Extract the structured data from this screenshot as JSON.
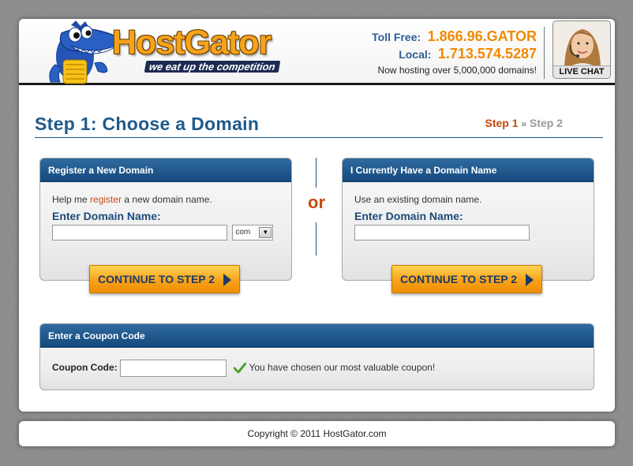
{
  "header": {
    "logo_text": "HostGator",
    "tagline": "we eat up the competition",
    "toll_free_label": "Toll Free:",
    "toll_free_number": "1.866.96.GATOR",
    "local_label": "Local:",
    "local_number": "1.713.574.5287",
    "hosting_note": "Now hosting over 5,000,000 domains!",
    "live_chat_label": "LIVE CHAT"
  },
  "step": {
    "title": "Step 1: Choose a Domain",
    "current": "Step 1",
    "separator": "»",
    "next": "Step 2"
  },
  "register_panel": {
    "header": "Register a New Domain",
    "help_prefix": "Help me ",
    "help_link": "register",
    "help_suffix": " a new domain name.",
    "field_label": "Enter Domain Name:",
    "domain_value": "",
    "tld_selected": "com",
    "button_label": "CONTINUE TO STEP 2"
  },
  "divider_text": "or",
  "existing_panel": {
    "header": "I Currently Have a Domain Name",
    "help_text": "Use an existing domain name.",
    "field_label": "Enter Domain Name:",
    "domain_value": "",
    "button_label": "CONTINUE TO STEP 2"
  },
  "coupon_panel": {
    "header": "Enter a Coupon Code",
    "field_label": "Coupon Code:",
    "coupon_value": "",
    "message": "You have chosen our most valuable coupon!"
  },
  "footer": {
    "copyright": "Copyright © 2011 HostGator.com"
  },
  "colors": {
    "brand_orange": "#f7a21b",
    "brand_blue": "#1f5a8a",
    "accent_red": "#c84a0a",
    "success_green": "#4aa52e"
  }
}
